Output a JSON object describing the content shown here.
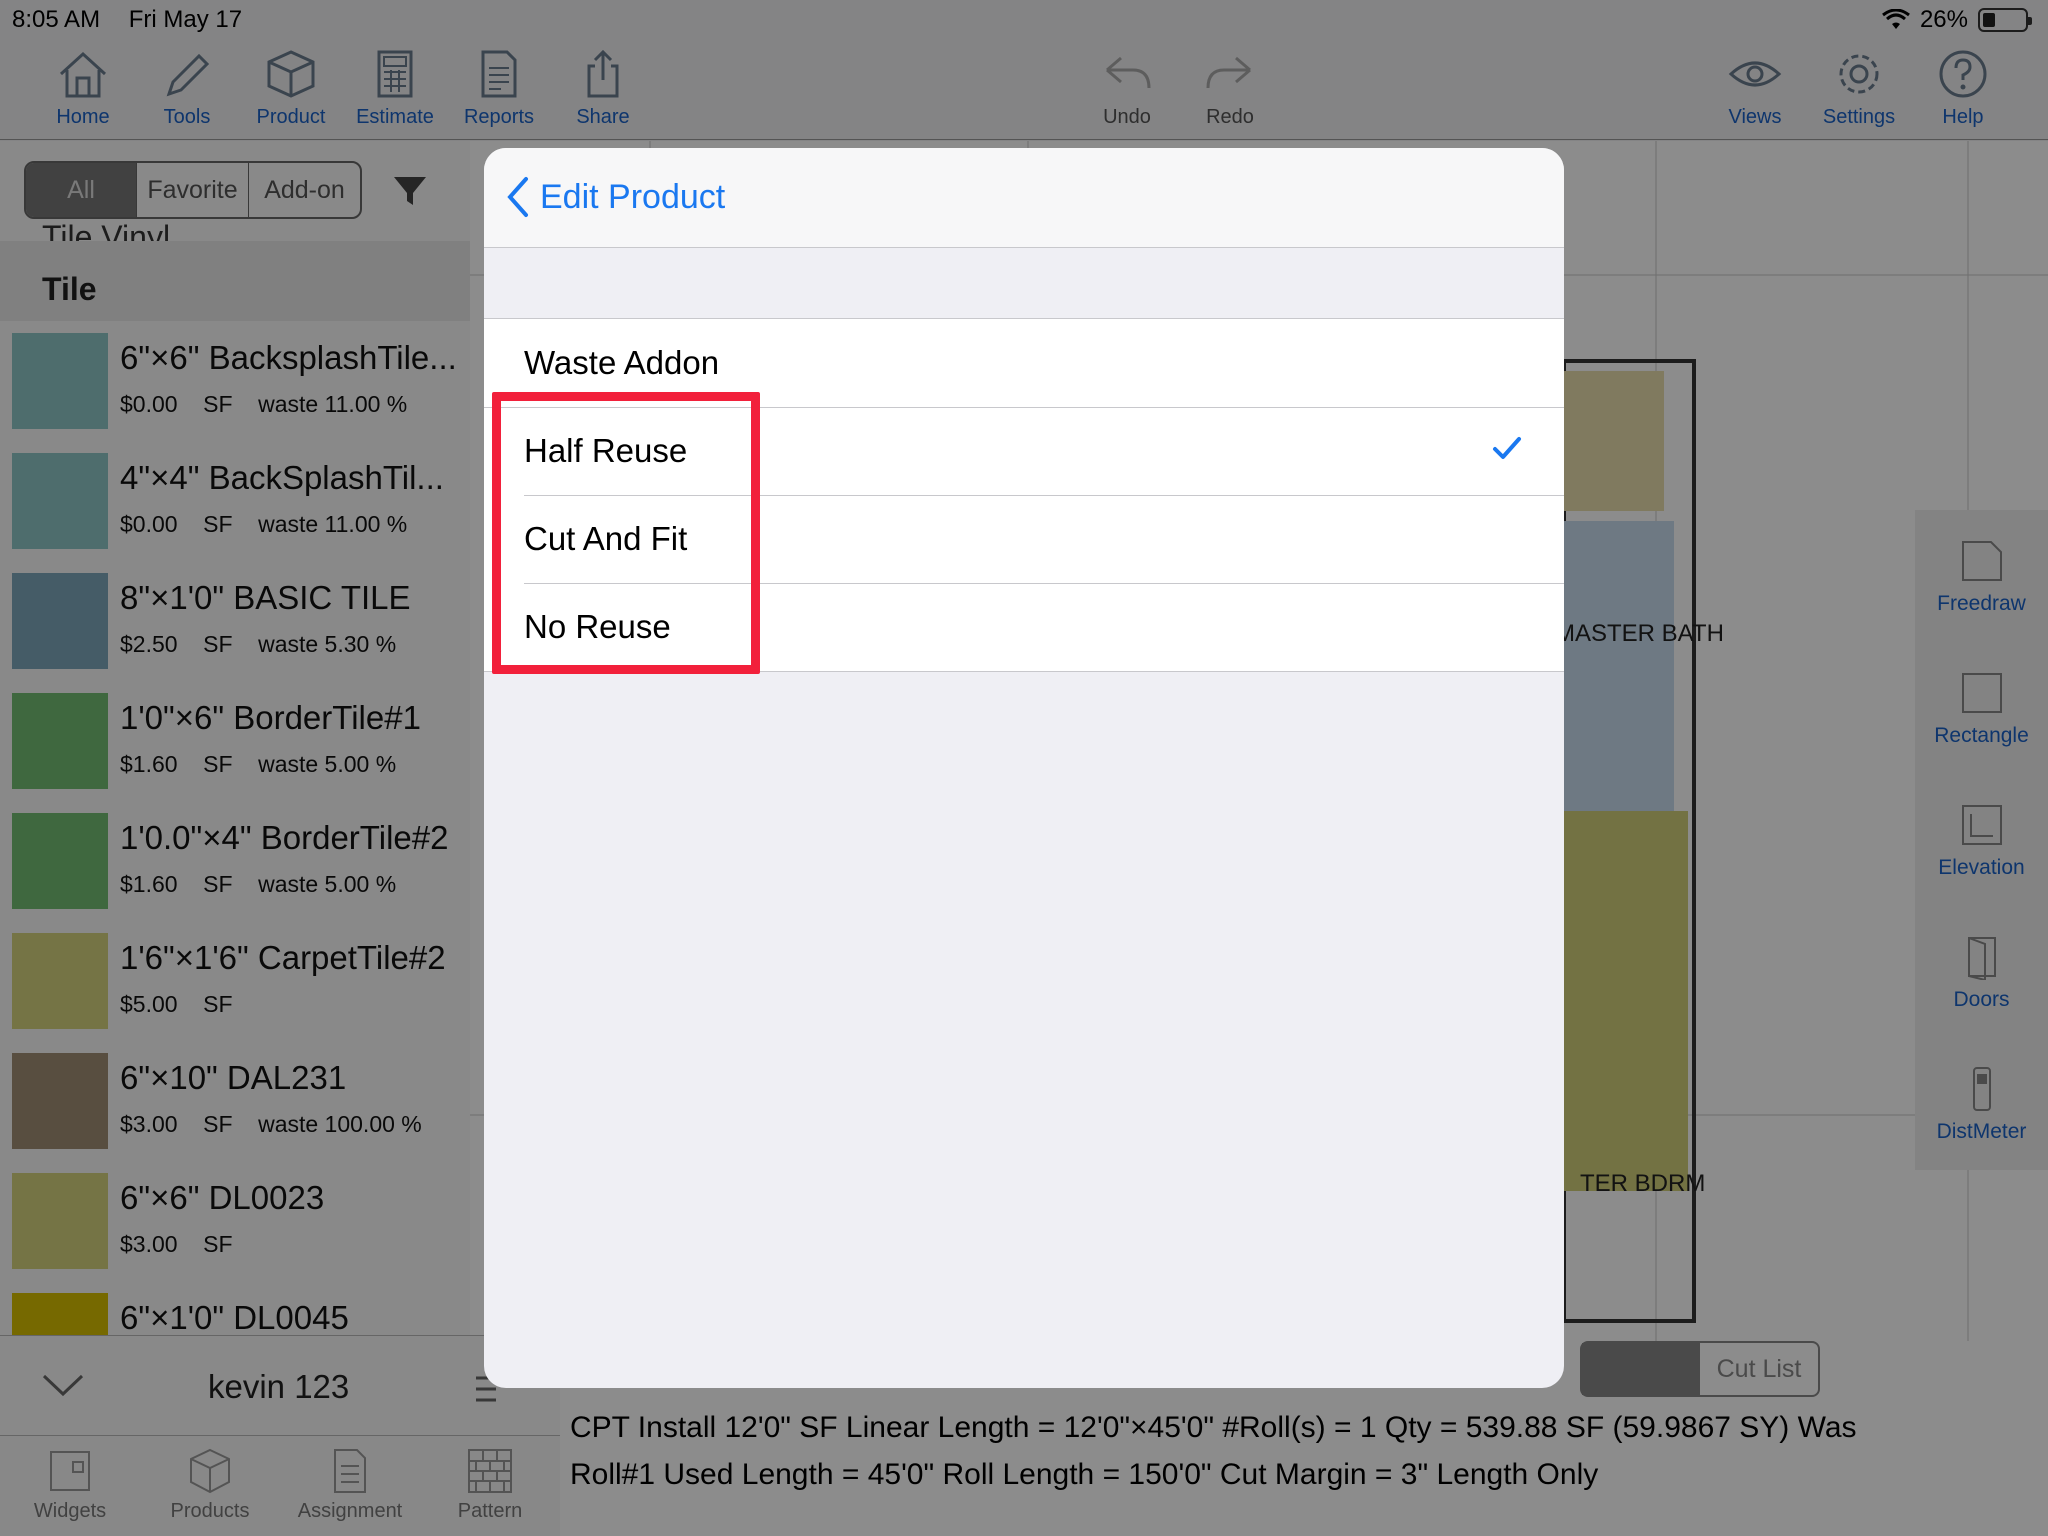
{
  "status": {
    "time": "8:05 AM",
    "date": "Fri May 17",
    "battery": "26%",
    "battery_level": 0.26
  },
  "toolbar": {
    "home": "Home",
    "tools": "Tools",
    "product": "Product",
    "estimate": "Estimate",
    "reports": "Reports",
    "share": "Share",
    "undo": "Undo",
    "redo": "Redo",
    "views": "Views",
    "settings": "Settings",
    "help": "Help"
  },
  "left_panel": {
    "segments": [
      "All",
      "Favorite",
      "Add-on"
    ],
    "prev_section": "Tile Vinyl",
    "section": "Tile",
    "products": [
      {
        "name": "6\"×6\" BacksplashTile...",
        "price": "$0.00",
        "unit": "SF",
        "waste": "waste 11.00 %",
        "color": "#8ec6c6"
      },
      {
        "name": "4\"×4\" BackSplashTil...",
        "price": "$0.00",
        "unit": "SF",
        "waste": "waste 11.00 %",
        "color": "#8ec6c6"
      },
      {
        "name": "8\"×1'0\" BASIC TILE",
        "price": "$2.50",
        "unit": "SF",
        "waste": "waste 5.30 %",
        "color": "#7ea8bc"
      },
      {
        "name": "1'0\"×6\" BorderTile#1",
        "price": "$1.60",
        "unit": "SF",
        "waste": "waste 5.00 %",
        "color": "#73bd73"
      },
      {
        "name": "1'0.0\"×4\" BorderTile#2",
        "price": "$1.60",
        "unit": "SF",
        "waste": "waste 5.00 %",
        "color": "#73bd73"
      },
      {
        "name": "1'6\"×1'6\" CarpetTile#2",
        "price": "$5.00",
        "unit": "SF",
        "waste": "",
        "color": "#d6d47f"
      },
      {
        "name": "6\"×10\" DAL231",
        "price": "$3.00",
        "unit": "SF",
        "waste": "waste 100.00 %",
        "color": "#a08f76"
      },
      {
        "name": "6\"×6\" DL0023",
        "price": "$3.00",
        "unit": "SF",
        "waste": "",
        "color": "#d6d47f"
      },
      {
        "name": "6\"×1'0\" DL0045",
        "price": "",
        "unit": "",
        "waste": "",
        "color": "#d8c000"
      }
    ],
    "user": "kevin 123"
  },
  "bottom_tabs": {
    "widgets": "Widgets",
    "products": "Products",
    "assignment": "Assignment",
    "pattern": "Pattern"
  },
  "right_tools": {
    "freedraw": "Freedraw",
    "rectangle": "Rectangle",
    "elevation": "Elevation",
    "doors": "Doors",
    "distmeter": "DistMeter"
  },
  "bottom_info": {
    "cut_list": "Cut List",
    "line1": "CPT Install 12'0\" SF   Linear Length = 12'0\"×45'0\"   #Roll(s) = 1   Qty = 539.88 SF (59.9867 SY)   Was",
    "line2": "Roll#1  Used Length = 45'0\"   Roll Length = 150'0\"   Cut Margin = 3\"   Length Only"
  },
  "modal": {
    "back_label": "Edit Product",
    "options": [
      "Waste Addon",
      "Half Reuse",
      "Cut And Fit",
      "No Reuse"
    ],
    "selected": "Half Reuse"
  },
  "colors": {
    "accent": "#1a78f0",
    "highlight": "#f2203b"
  }
}
